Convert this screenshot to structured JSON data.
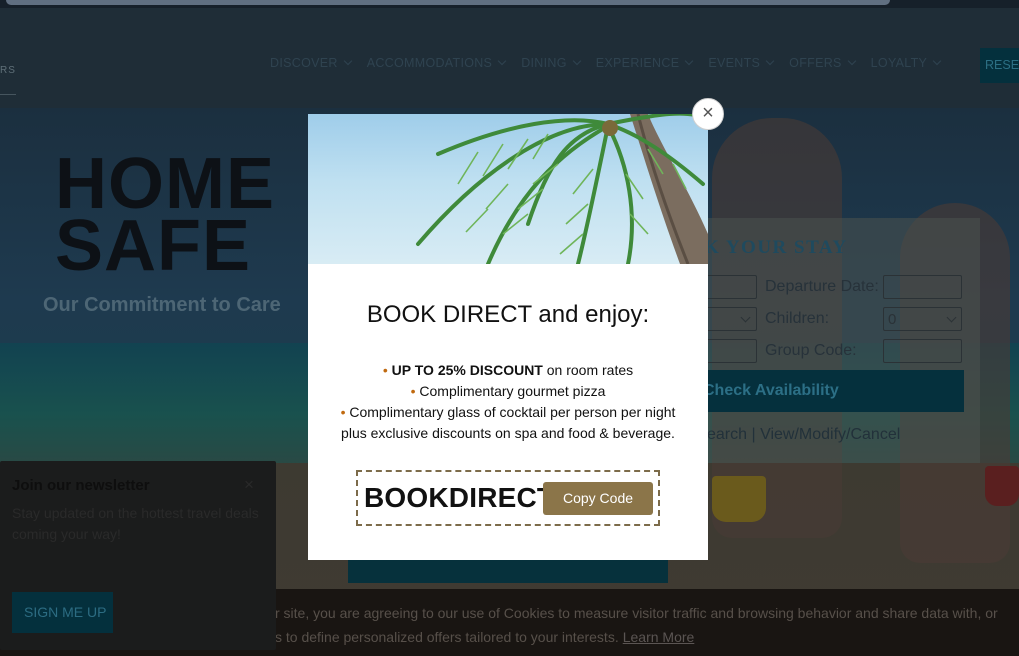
{
  "colors": {
    "overlay_dark": "#1d2a33",
    "brand_navy": "#04303d",
    "gold_button": "#8b7549",
    "code_border": "#7c6b4a",
    "bullet": "#c06a10"
  },
  "header": {
    "logo_fragment": "RS",
    "nav": [
      {
        "label": "DISCOVER"
      },
      {
        "label": "ACCOMMODATIONS"
      },
      {
        "label": "DINING"
      },
      {
        "label": "EXPERIENCE"
      },
      {
        "label": "EVENTS"
      },
      {
        "label": "OFFERS"
      },
      {
        "label": "LOYALTY"
      }
    ],
    "reserve_label": "RESE"
  },
  "hero": {
    "title_line1": "HOME",
    "title_line2": "SAFE",
    "subtitle": "Our Commitment to Care"
  },
  "booking": {
    "title": "K YOUR STAY",
    "departure_label": "Departure Date:",
    "children_label": "Children:",
    "children_value": "0",
    "group_code_label": "Group Code:",
    "check_button": "Check Availability",
    "links": "earch | View/Modify/Cancel"
  },
  "modal": {
    "close_icon": "×",
    "heading": "BOOK DIRECT and enjoy:",
    "items": [
      {
        "bold": "UP TO 25% DISCOUNT",
        "text": " on room rates"
      },
      {
        "bold": "",
        "text": "Complimentary gourmet pizza"
      },
      {
        "bold": "",
        "text": "Complimentary glass of cocktail per person per night"
      }
    ],
    "item3_continuation": "plus exclusive discounts on spa and food & beverage.",
    "promo_code": "BOOKDIRECT",
    "copy_button": "Copy Code"
  },
  "newsletter": {
    "title": "Join our newsletter",
    "close_icon": "×",
    "body": "Stay updated on the hottest travel deals coming your way!",
    "button": "SIGN ME UP"
  },
  "cookie": {
    "line1": "r site, you are agreeing to our use of Cookies to measure visitor traffic and browsing behavior and share data with, or",
    "line2": "s to define personalized offers tailored to your interests.",
    "learn_more": "Learn More"
  }
}
